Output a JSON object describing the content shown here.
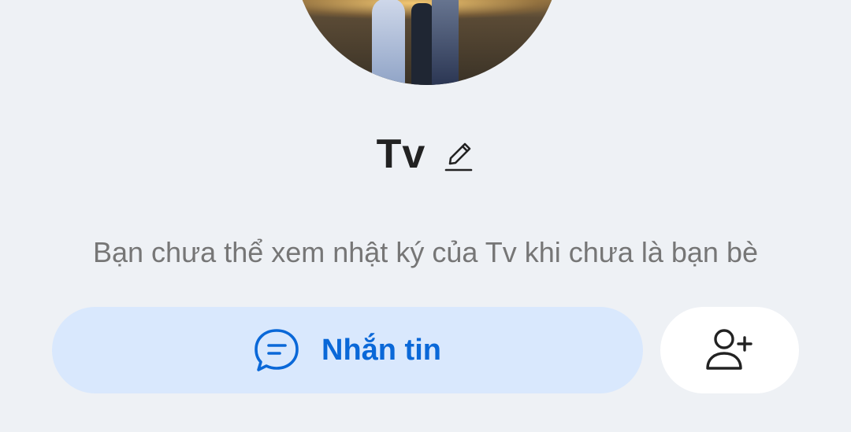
{
  "profile": {
    "name": "Tv",
    "notice": "Bạn chưa thể xem nhật ký của Tv khi chưa là bạn bè"
  },
  "actions": {
    "message_label": "Nhắn tin",
    "message_icon": "chat-bubble-icon",
    "add_friend_icon": "add-friend-icon"
  },
  "colors": {
    "background": "#eef1f5",
    "accent": "#0a68d8",
    "message_button_bg": "#d9e8fd"
  }
}
